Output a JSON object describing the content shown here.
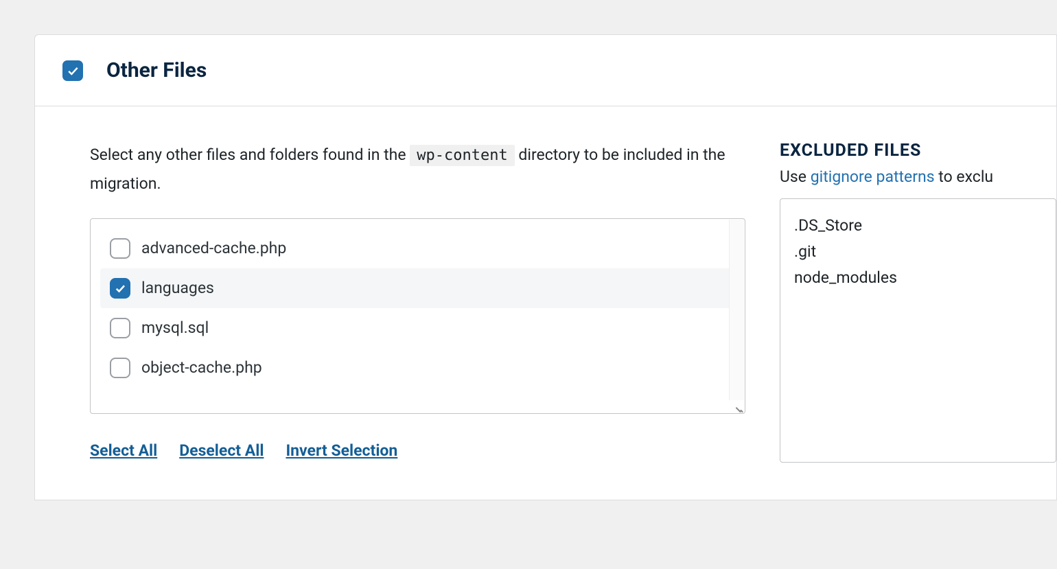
{
  "header": {
    "checked": true,
    "title": "Other Files"
  },
  "instruction": {
    "pre": "Select any other files and folders found in the ",
    "code": "wp-content",
    "post": " directory to be included in the migration."
  },
  "files": [
    {
      "label": "advanced-cache.php",
      "checked": false
    },
    {
      "label": "languages",
      "checked": true
    },
    {
      "label": "mysql.sql",
      "checked": false
    },
    {
      "label": "object-cache.php",
      "checked": false
    }
  ],
  "actions": {
    "select_all": "Select All",
    "deselect_all": "Deselect All",
    "invert": "Invert Selection"
  },
  "excluded": {
    "title": "EXCLUDED FILES",
    "desc_pre": "Use ",
    "link_text": "gitignore patterns",
    "desc_post": " to exclu",
    "value": ".DS_Store\n.git\nnode_modules"
  }
}
